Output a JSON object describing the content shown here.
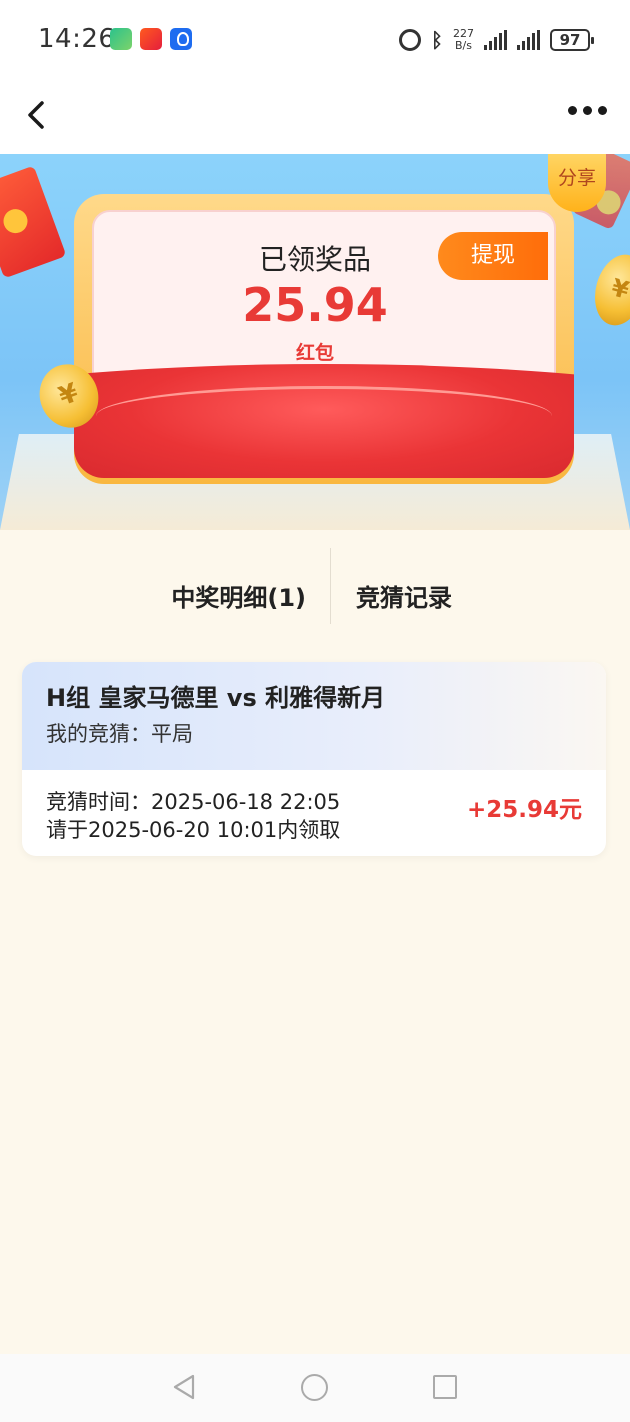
{
  "status_bar": {
    "time": "14:26",
    "network_speed_value": "227",
    "network_speed_unit": "B/s",
    "battery": "97",
    "icons": [
      "app-icon-1",
      "app-icon-2",
      "app-icon-3",
      "alarm-icon",
      "bluetooth-icon",
      "wifi-signal-icon",
      "cell-signal-icon",
      "battery-icon"
    ]
  },
  "nav": {
    "back_icon": "chevron-left-icon",
    "more_icon": "more-dots-icon"
  },
  "banner": {
    "share_label": "分享",
    "title": "已领奖品",
    "amount": "25.94",
    "unit_label": "红包",
    "withdraw_label": "提现",
    "coin_symbol": "¥",
    "colors": {
      "amount": "#e83a36",
      "withdraw_button": "#ff7a12"
    }
  },
  "tabs": [
    {
      "label": "中奖明细(1)",
      "active": true
    },
    {
      "label": "竞猜记录",
      "active": false
    }
  ],
  "records": [
    {
      "match": "H组 皇家马德里 vs 利雅得新月",
      "my_guess": "我的竞猜：平局",
      "guess_time": "竞猜时间：2025-06-18 22:05",
      "claim_before": "请于2025-06-20 10:01内领取",
      "prize": "+25.94元"
    }
  ]
}
